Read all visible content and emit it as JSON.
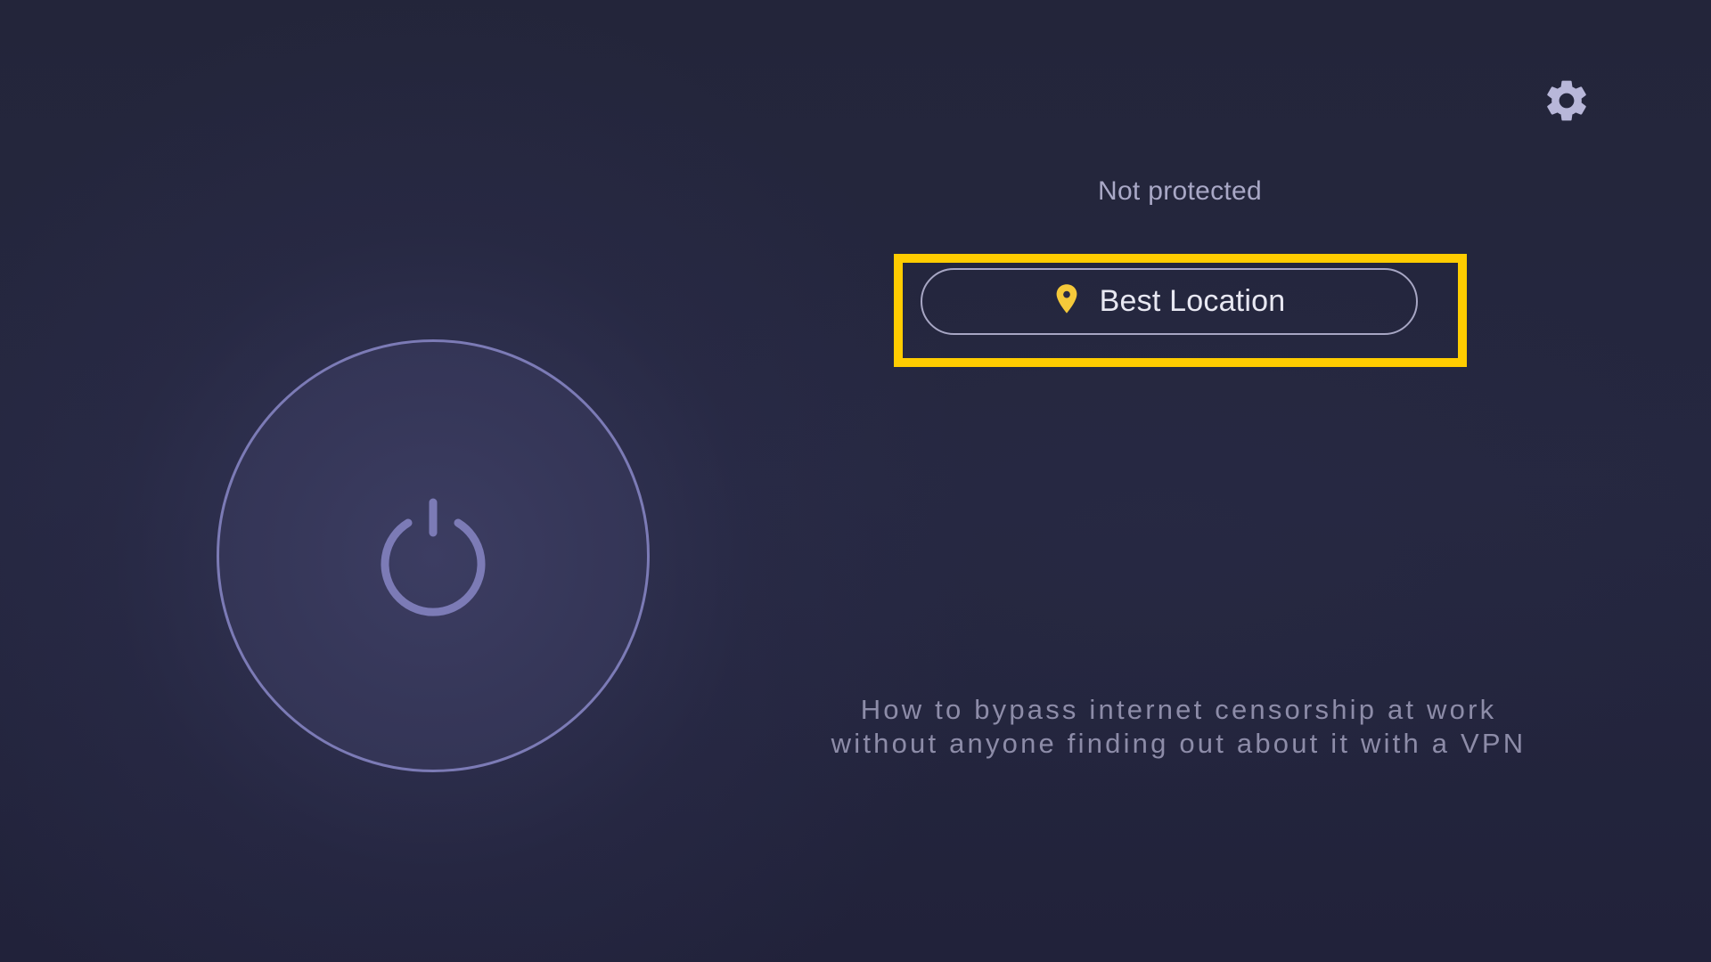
{
  "header": {
    "settings_icon": "gear-icon"
  },
  "status": {
    "text": "Not protected"
  },
  "location": {
    "icon": "location-pin-icon",
    "label": "Best Location"
  },
  "power": {
    "icon": "power-icon"
  },
  "article": {
    "text": "How to bypass internet censorship at work without anyone finding out about it with a VPN"
  },
  "colors": {
    "background": "#23253a",
    "focus_highlight": "#ffcc00",
    "pin": "#f5c93a",
    "power_accent": "#7c7bb6",
    "icon": "#b8b7d9"
  }
}
